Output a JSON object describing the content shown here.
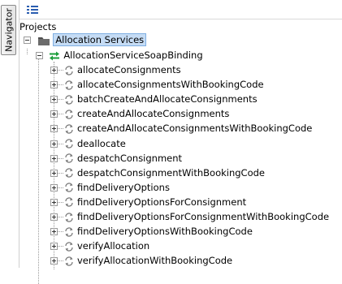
{
  "navigator_tab": {
    "label": "Navigator"
  },
  "toolbar": {
    "icon": "list-view-icon"
  },
  "tree": {
    "root_label": "Projects",
    "project": {
      "label": "Allocation Services",
      "icon": "folder-icon"
    },
    "interface": {
      "label": "AllocationServiceSoapBinding",
      "icon": "binding-arrows-icon"
    },
    "operations": [
      "allocateConsignments",
      "allocateConsignmentsWithBookingCode",
      "batchCreateAndAllocateConsignments",
      "createAndAllocateConsignments",
      "createAndAllocateConsignmentsWithBookingCode",
      "deallocate",
      "despatchConsignment",
      "despatchConsignmentWithBookingCode",
      "findDeliveryOptions",
      "findDeliveryOptionsForConsignment",
      "findDeliveryOptionsForConsignmentWithBookingCode",
      "findDeliveryOptionsWithBookingCode",
      "verifyAllocation",
      "verifyAllocationWithBookingCode"
    ]
  },
  "colors": {
    "selection_bg": "#c5dcf5",
    "selection_border": "#7eaee2",
    "binding_green": "#1a9c3a"
  }
}
